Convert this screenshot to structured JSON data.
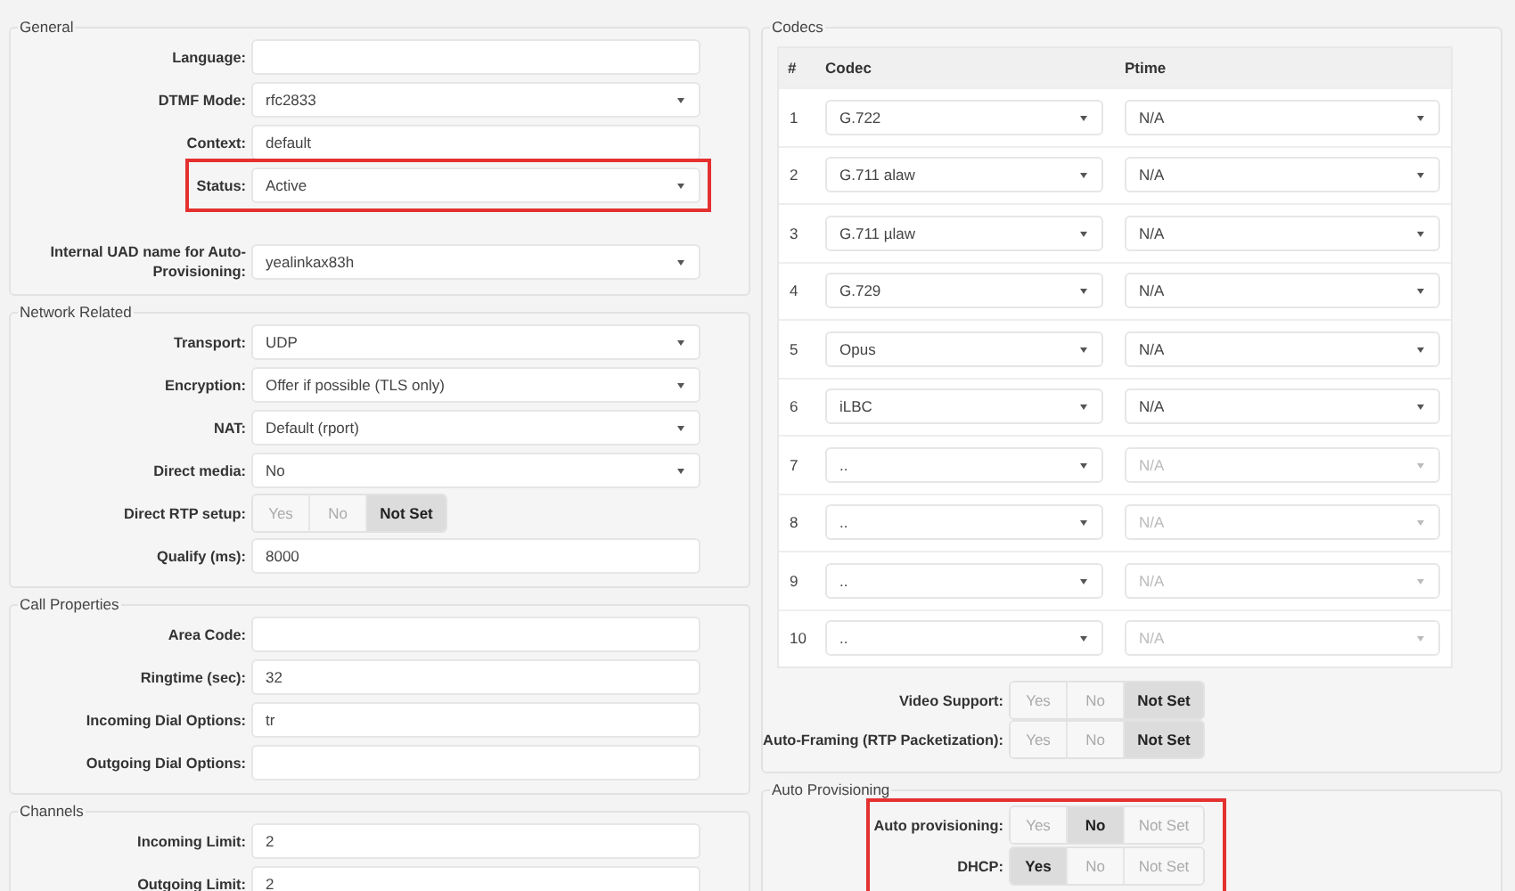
{
  "left_sections": [
    {
      "title": "General",
      "fields": [
        {
          "kind": "input",
          "label": "Language:"
        },
        {
          "kind": "select",
          "label": "DTMF Mode:",
          "value": "rfc2833"
        },
        {
          "kind": "input",
          "label": "Context:",
          "value": "default"
        },
        {
          "kind": "select",
          "label": "Status:",
          "value": "Active",
          "highlighted": true
        },
        {
          "kind": "select",
          "label": "Internal UAD name for Auto-Provisioning:",
          "value": "yealinkax83h",
          "spaced": true
        }
      ]
    },
    {
      "title": "Network Related",
      "fields": [
        {
          "kind": "select",
          "label": "Transport:",
          "value": "UDP"
        },
        {
          "kind": "select",
          "label": "Encryption:",
          "value": "Offer if possible (TLS only)"
        },
        {
          "kind": "select",
          "label": "NAT:",
          "value": "Default (rport)"
        },
        {
          "kind": "select",
          "label": "Direct media:",
          "value": "No"
        },
        {
          "kind": "segmented",
          "label": "Direct RTP setup:",
          "options": [
            {
              "label": "Yes",
              "selected": false
            },
            {
              "label": "No",
              "selected": false
            },
            {
              "label": "Not Set",
              "selected": true
            }
          ]
        },
        {
          "kind": "input",
          "label": "Qualify (ms):",
          "value": "8000"
        }
      ]
    },
    {
      "title": "Call Properties",
      "fields": [
        {
          "kind": "input",
          "label": "Area Code:"
        },
        {
          "kind": "input",
          "label": "Ringtime (sec):",
          "value": "32"
        },
        {
          "kind": "input",
          "label": "Incoming Dial Options:",
          "value": "tr"
        },
        {
          "kind": "input",
          "label": "Outgoing Dial Options:"
        }
      ]
    },
    {
      "title": "Channels",
      "fields": [
        {
          "kind": "input",
          "label": "Incoming Limit:",
          "value": "2"
        },
        {
          "kind": "input",
          "label": "Outgoing Limit:",
          "value": "2"
        }
      ]
    }
  ],
  "codecs": {
    "title": "Codecs",
    "columns": [
      "#",
      "Codec",
      "Ptime"
    ],
    "rows": [
      {
        "number": "1",
        "codec": "G.722",
        "ptime": "N/A",
        "disabled": false
      },
      {
        "number": "2",
        "codec": "G.711 alaw",
        "ptime": "N/A",
        "disabled": false
      },
      {
        "number": "3",
        "codec": "G.711 µlaw",
        "ptime": "N/A",
        "disabled": false
      },
      {
        "number": "4",
        "codec": "G.729",
        "ptime": "N/A",
        "disabled": false
      },
      {
        "number": "5",
        "codec": "Opus",
        "ptime": "N/A",
        "disabled": false
      },
      {
        "number": "6",
        "codec": "iLBC",
        "ptime": "N/A",
        "disabled": false
      },
      {
        "number": "7",
        "codec": "..",
        "ptime": "N/A",
        "disabled": true
      },
      {
        "number": "8",
        "codec": "..",
        "ptime": "N/A",
        "disabled": true
      },
      {
        "number": "9",
        "codec": "..",
        "ptime": "N/A",
        "disabled": true
      },
      {
        "number": "10",
        "codec": "..",
        "ptime": "N/A",
        "disabled": true
      }
    ],
    "fields": [
      {
        "label": "Video Support:",
        "options": [
          {
            "label": "Yes",
            "selected": false
          },
          {
            "label": "No",
            "selected": false
          },
          {
            "label": "Not Set",
            "selected": true
          }
        ]
      },
      {
        "label": "Auto-Framing (RTP Packetization):",
        "options": [
          {
            "label": "Yes",
            "selected": false
          },
          {
            "label": "No",
            "selected": false
          },
          {
            "label": "Not Set",
            "selected": true
          }
        ]
      }
    ]
  },
  "auto_provisioning": {
    "title": "Auto Provisioning",
    "highlighted": true,
    "fields": [
      {
        "label": "Auto provisioning:",
        "options": [
          {
            "label": "Yes",
            "selected": false
          },
          {
            "label": "No",
            "selected": true
          },
          {
            "label": "Not Set",
            "selected": false
          }
        ]
      },
      {
        "label": "DHCP:",
        "options": [
          {
            "label": "Yes",
            "selected": true
          },
          {
            "label": "No",
            "selected": false
          },
          {
            "label": "Not Set",
            "selected": false
          }
        ]
      }
    ]
  }
}
